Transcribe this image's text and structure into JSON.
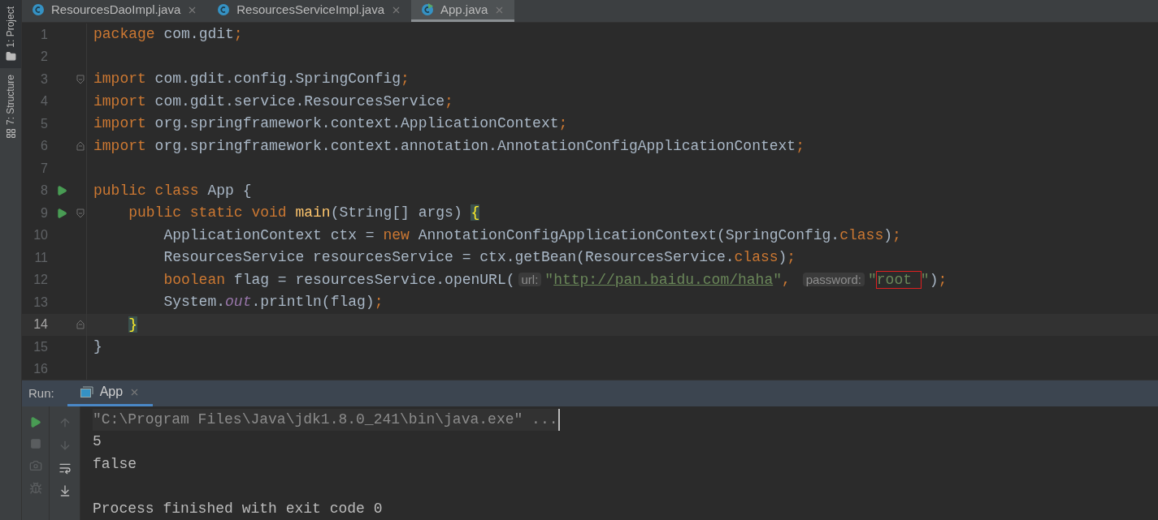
{
  "tool_strip": [
    {
      "label": "1: Project",
      "kind": "project"
    },
    {
      "label": "7: Structure",
      "kind": "structure"
    }
  ],
  "tabs": [
    {
      "label": "ResourcesDaoImpl.java",
      "selected": false,
      "runnable": false
    },
    {
      "label": "ResourcesServiceImpl.java",
      "selected": false,
      "runnable": false
    },
    {
      "label": "App.java",
      "selected": true,
      "runnable": true
    }
  ],
  "editor": {
    "lines": [
      {
        "number": "1",
        "tokens": [
          {
            "text": "package",
            "kind": "kw"
          },
          {
            "text": " com.gdit",
            "kind": "plain"
          },
          {
            "text": ";",
            "kind": "punct"
          }
        ]
      },
      {
        "number": "2"
      },
      {
        "number": "3",
        "fold": {
          "kind": "start"
        },
        "tokens": [
          {
            "text": "import",
            "kind": "kw"
          },
          {
            "text": " com.gdit.config.SpringConfig",
            "kind": "plain"
          },
          {
            "text": ";",
            "kind": "punct"
          }
        ]
      },
      {
        "number": "4",
        "tokens": [
          {
            "text": "import",
            "kind": "kw"
          },
          {
            "text": " com.gdit.service.ResourcesService",
            "kind": "plain"
          },
          {
            "text": ";",
            "kind": "punct"
          }
        ]
      },
      {
        "number": "5",
        "tokens": [
          {
            "text": "import",
            "kind": "kw"
          },
          {
            "text": " org.springframework.context.ApplicationContext",
            "kind": "plain"
          },
          {
            "text": ";",
            "kind": "punct"
          }
        ]
      },
      {
        "number": "6",
        "fold": {
          "kind": "end"
        },
        "tokens": [
          {
            "text": "import",
            "kind": "kw"
          },
          {
            "text": " org.springframework.context.annotation.AnnotationConfigApplicationContext",
            "kind": "plain"
          },
          {
            "text": ";",
            "kind": "punct"
          }
        ]
      },
      {
        "number": "7"
      },
      {
        "number": "8",
        "run": true,
        "tokens": [
          {
            "text": "public class",
            "kind": "kw"
          },
          {
            "text": " App {",
            "kind": "plain"
          }
        ]
      },
      {
        "number": "9",
        "run": true,
        "fold": {
          "kind": "start"
        },
        "tokens": [
          {
            "text": "    public static void",
            "kind": "kw"
          },
          {
            "text": " main",
            "kind": "method"
          },
          {
            "text": "(String[] args) ",
            "kind": "plain"
          },
          {
            "text": "{",
            "kind": "brace"
          }
        ]
      },
      {
        "number": "10",
        "tokens": [
          {
            "text": "        ApplicationContext ctx = ",
            "kind": "plain"
          },
          {
            "text": "new",
            "kind": "kw"
          },
          {
            "text": " AnnotationConfigApplicationContext(SpringConfig.",
            "kind": "plain"
          },
          {
            "text": "class",
            "kind": "kw"
          },
          {
            "text": ")",
            "kind": "plain"
          },
          {
            "text": ";",
            "kind": "punct"
          }
        ]
      },
      {
        "number": "11",
        "tokens": [
          {
            "text": "        ResourcesService resourcesService = ctx.getBean(ResourcesService.",
            "kind": "plain"
          },
          {
            "text": "class",
            "kind": "kw"
          },
          {
            "text": ")",
            "kind": "plain"
          },
          {
            "text": ";",
            "kind": "punct"
          }
        ]
      },
      {
        "number": "12",
        "tokens": [
          {
            "text": "        boolean",
            "kind": "kw"
          },
          {
            "text": " flag = resourcesService.openURL(",
            "kind": "plain"
          },
          {
            "text": "url:",
            "kind": "hint"
          },
          {
            "text": "\"",
            "kind": "str"
          },
          {
            "text": "http://pan.baidu.com/haha",
            "kind": "url"
          },
          {
            "text": "\"",
            "kind": "str"
          },
          {
            "text": ", ",
            "kind": "punct"
          },
          {
            "text": "password:",
            "kind": "hint"
          },
          {
            "text": "\"",
            "kind": "str"
          },
          {
            "text": "root ",
            "kind": "boxed"
          },
          {
            "text": "\"",
            "kind": "str"
          },
          {
            "text": ")",
            "kind": "plain"
          },
          {
            "text": ";",
            "kind": "punct"
          }
        ]
      },
      {
        "number": "13",
        "tokens": [
          {
            "text": "        System.",
            "kind": "plain"
          },
          {
            "text": "out",
            "kind": "field"
          },
          {
            "text": ".println(flag)",
            "kind": "plain"
          },
          {
            "text": ";",
            "kind": "punct"
          }
        ]
      },
      {
        "number": "14",
        "current": true,
        "fold": {
          "kind": "end"
        },
        "tokens": [
          {
            "text": "    }",
            "kind": "brace"
          }
        ]
      },
      {
        "number": "15",
        "tokens": [
          {
            "text": "}",
            "kind": "plain"
          }
        ]
      },
      {
        "number": "16"
      }
    ]
  },
  "run_panel": {
    "label": "Run:",
    "tabs": [
      {
        "label": "App",
        "selected": true
      }
    ],
    "output": [
      {
        "text": "\"C:\\Program Files\\Java\\jdk1.8.0_241\\bin\\java.exe\" ...",
        "kind": "command"
      },
      {
        "text": "5",
        "kind": "out"
      },
      {
        "text": "false",
        "kind": "out"
      },
      {
        "text": "Process finished with exit code 0",
        "kind": "exit"
      }
    ]
  }
}
